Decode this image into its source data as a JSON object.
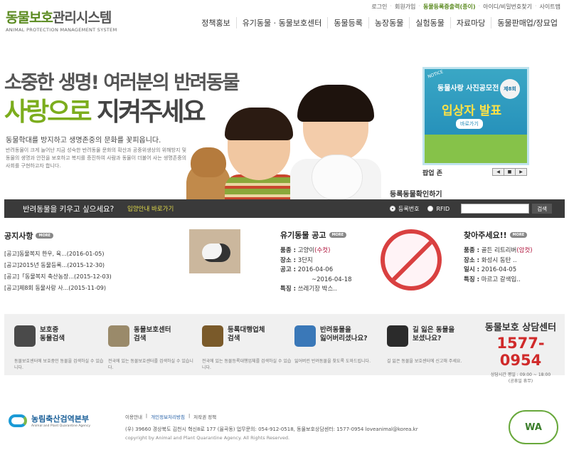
{
  "header": {
    "logo_part1": "동물보호",
    "logo_part2": "관리시스템",
    "logo_sub": "ANIMAL PROTECTION MANAGEMENT SYSTEM",
    "util": [
      "로그인",
      "회원가입",
      "동물등록증출력(종이)",
      "아이디/비밀번호찾기",
      "사이트맵"
    ],
    "nav": [
      "정책홍보",
      "유기동물 · 동물보호센터",
      "동물등록",
      "농장동물",
      "실험동물",
      "자료마당",
      "동물판매업/장묘업"
    ]
  },
  "hero": {
    "line1": "소중한 생명! 여러분의 반려동물",
    "line2_green": "사랑으로",
    "line2_dark": " 지켜주세요",
    "sub": "동물학대를 방지하고 생명존중의 문화를 꽃피웁니다.",
    "desc": "반려동물이 크게 늘어난 지금 성숙한 반려동물 문화의 확산과 공중위생상의 위해방지 및 동물의 생명과 안전을 보호하고 복지를 증진하여 사람과 동물이 더불어 사는 생명존중의 사회를 구현하고자 합니다."
  },
  "popup": {
    "notice": "NOTICE",
    "title": "동물사랑 사진공모전",
    "badge": "제8회",
    "main": "입상자 발표",
    "btn": "바로가기",
    "label": "팝업 존",
    "ctrl": [
      "◀",
      "■",
      "▶"
    ]
  },
  "bar": {
    "question": "반려동물을 키우고 싶으세요?",
    "link": "입양안내 바로가기",
    "reg_title": "등록동물확인하기",
    "opt1": "등록번호",
    "opt2": "RFID",
    "search": "검색"
  },
  "notice": {
    "title": "공지사항",
    "more": "MORE",
    "items": [
      "[공고]동물복지 한우, 육...(2016-01-05)",
      "[공고]2015년 동물등록...(2015-12-30)",
      "[공고]「동물복지 축산농장...(2015-12-03)",
      "[공고]제8회 동물사랑 사...(2015-11-09)"
    ]
  },
  "abandon": {
    "title": "유기동물 공고",
    "more": "MORE",
    "kind_label": "품종 :",
    "kind": "고양이",
    "kind_sex": "(수컷)",
    "place_label": "장소 :",
    "place": "3단지",
    "date_label": "공고 :",
    "date_from": "2016-04-06",
    "date_to": "~2016-04-18",
    "feature_label": "특징 :",
    "feature": "쓰레기장 박스.."
  },
  "ask": {
    "title": "찾아주세요!!",
    "more": "MORE",
    "kind_label": "품종 :",
    "kind": "골든 리트리버",
    "kind_sex": "(암컷)",
    "place_label": "장소 :",
    "place": "화성시 동탄 ..",
    "date_label": "일시 :",
    "date": "2016-04-05",
    "feature_label": "특징 :",
    "feature": "마르고 갈색입.."
  },
  "services": [
    {
      "title": "보호중\n동물검색",
      "desc": "동물보호센터에 보호중인 동물을 검색하실 수 있습니다.",
      "color": "#4a4a4a"
    },
    {
      "title": "동물보호센터\n검색",
      "desc": "전국에 있는 동물보호센터를 검색하실 수 있습니다.",
      "color": "#9a8a6a"
    },
    {
      "title": "등록대행업체\n검색",
      "desc": "전국에 있는 동물등록대행업체를 검색하실 수 있습니다.",
      "color": "#7a5a2a"
    },
    {
      "title": "반려동물을\n잃어버리셨나요?",
      "desc": "잃어버린 반려동물을 찾도록 도와드립니다.",
      "color": "#3a78b8"
    },
    {
      "title": "길 잃은 동물을\n보셨나요?",
      "desc": "길 잃은 동물을 보호센터에 신고해 주세요.",
      "color": "#2b2b2b"
    }
  ],
  "center": {
    "title": "동물보호 상담센터",
    "phone": "1577-0954",
    "hours": "상담시간 평일 : 09:00 ~ 18:00",
    "hours2": "(공휴일 휴무)"
  },
  "footer": {
    "org": "농림축산검역본부",
    "org_sub": "Animal and Plant Quarantine Agency",
    "links": [
      "이용안내",
      "개인정보처리방침",
      "저작권 정책"
    ],
    "address": "(우) 39660   경상북도 김천시 혁신8로 177 (율곡동)   업무문의: 054-912-0518,  동물보호상담센터: 1577-0954     loveanimal@korea.kr",
    "copyright": "copyright by Animal and Plant Quarantine Agency. All Rights Reserved.",
    "wa": "WA"
  }
}
